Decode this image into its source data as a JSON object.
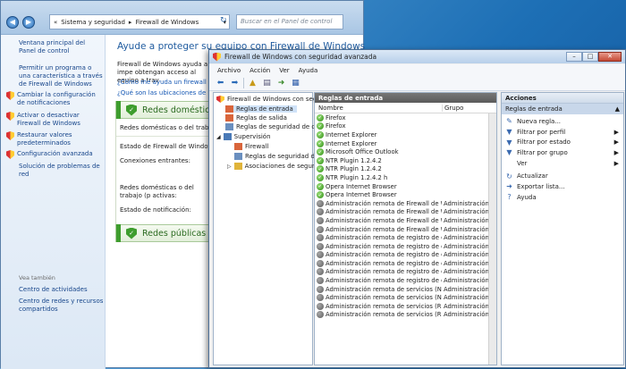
{
  "control_panel": {
    "breadcrumb": [
      "Sistema y seguridad",
      "Firewall de Windows"
    ],
    "search_placeholder": "Buscar en el Panel de control",
    "sidebar": {
      "items": [
        "Ventana principal del Panel de control",
        "Permitir un programa o una característica a través de Firewall de Windows",
        "Cambiar la configuración de notificaciones",
        "Activar o desactivar Firewall de Windows",
        "Restaurar valores predeterminados",
        "Configuración avanzada",
        "Solución de problemas de red"
      ],
      "see_also_title": "Vea también",
      "see_also": [
        "Centro de actividades",
        "Centro de redes y recursos compartidos"
      ]
    },
    "main": {
      "title": "Ayude a proteger su equipo con Firewall de Windows",
      "intro": "Firewall de Windows ayuda a impe obtengan acceso al equipo a trav",
      "link1": "¿Cómo me ayuda un firewall a prot",
      "link2": "¿Qué son las ubicaciones de red?",
      "domestic_header": "Redes domésticas",
      "domestic_desc": "Redes domésticas o del trabajo en",
      "firewall_state_label": "Estado de Firewall de Windows:",
      "incoming_label": "Conexiones entrantes:",
      "active_networks_label": "Redes domésticas o del trabajo (p activas:",
      "notification_label": "Estado de notificación:",
      "public_header": "Redes públicas"
    }
  },
  "firewall_window": {
    "title": "Firewall de Windows con seguridad avanzada",
    "menu": [
      "Archivo",
      "Acción",
      "Ver",
      "Ayuda"
    ],
    "tree": {
      "root": "Firewall de Windows con segur",
      "items": [
        "Reglas de entrada",
        "Reglas de salida",
        "Reglas de seguridad de con"
      ],
      "monitoring": "Supervisión",
      "monitoring_items": [
        "Firewall",
        "Reglas de seguridad de co",
        "Asociaciones de segurid"
      ]
    },
    "list": {
      "header": "Reglas de entrada",
      "columns": [
        "Nombre",
        "Grupo"
      ],
      "rows": [
        {
          "name": "Firefox",
          "group": "",
          "enabled": true
        },
        {
          "name": "Firefox",
          "group": "",
          "enabled": true
        },
        {
          "name": "Internet Explorer",
          "group": "",
          "enabled": true
        },
        {
          "name": "Internet Explorer",
          "group": "",
          "enabled": true
        },
        {
          "name": "Microsoft Office Outlook",
          "group": "",
          "enabled": true
        },
        {
          "name": "NTR Plugin 1.2.4.2",
          "group": "",
          "enabled": true
        },
        {
          "name": "NTR Plugin 1.2.4.2",
          "group": "",
          "enabled": true
        },
        {
          "name": "NTR Plugin 1.2.4.2 h",
          "group": "",
          "enabled": true
        },
        {
          "name": "Opera Internet Browser",
          "group": "",
          "enabled": true
        },
        {
          "name": "Opera Internet Browser",
          "group": "",
          "enabled": true
        },
        {
          "name": "Administración remota de Firewall de Wi...",
          "group": "Administración re",
          "enabled": false
        },
        {
          "name": "Administración remota de Firewall de Wi...",
          "group": "Administración re",
          "enabled": false
        },
        {
          "name": "Administración remota de Firewall de Wi...",
          "group": "Administración re",
          "enabled": false
        },
        {
          "name": "Administración remota de Firewall de Wi...",
          "group": "Administración re",
          "enabled": false
        },
        {
          "name": "Administración remota de registro de ev...",
          "group": "Administración re",
          "enabled": false
        },
        {
          "name": "Administración remota de registro de ev...",
          "group": "Administración re",
          "enabled": false
        },
        {
          "name": "Administración remota de registro de ev...",
          "group": "Administración re",
          "enabled": false
        },
        {
          "name": "Administración remota de registro de ev...",
          "group": "Administración re",
          "enabled": false
        },
        {
          "name": "Administración remota de registro de ev...",
          "group": "Administración re",
          "enabled": false
        },
        {
          "name": "Administración remota de registro de ev...",
          "group": "Administración re",
          "enabled": false
        },
        {
          "name": "Administración remota de servicios (NP ...",
          "group": "Administración re",
          "enabled": false
        },
        {
          "name": "Administración remota de servicios (NP ...",
          "group": "Administración re",
          "enabled": false
        },
        {
          "name": "Administración remota de servicios (RPC)",
          "group": "Administración re",
          "enabled": false
        },
        {
          "name": "Administración remota de servicios (RPC)",
          "group": "Administración re",
          "enabled": false
        }
      ]
    },
    "actions": {
      "header": "Acciones",
      "section": "Reglas de entrada",
      "items": [
        {
          "label": "Nueva regla...",
          "icon": "new-rule-icon",
          "submenu": false
        },
        {
          "label": "Filtrar por perfil",
          "icon": "filter-icon",
          "submenu": true
        },
        {
          "label": "Filtrar por estado",
          "icon": "filter-icon",
          "submenu": true
        },
        {
          "label": "Filtrar por grupo",
          "icon": "filter-icon",
          "submenu": true
        },
        {
          "label": "Ver",
          "icon": "",
          "submenu": true
        },
        {
          "label": "Actualizar",
          "icon": "refresh-icon",
          "submenu": false
        },
        {
          "label": "Exportar lista...",
          "icon": "export-icon",
          "submenu": false
        },
        {
          "label": "Ayuda",
          "icon": "help-icon",
          "submenu": false
        }
      ]
    }
  }
}
